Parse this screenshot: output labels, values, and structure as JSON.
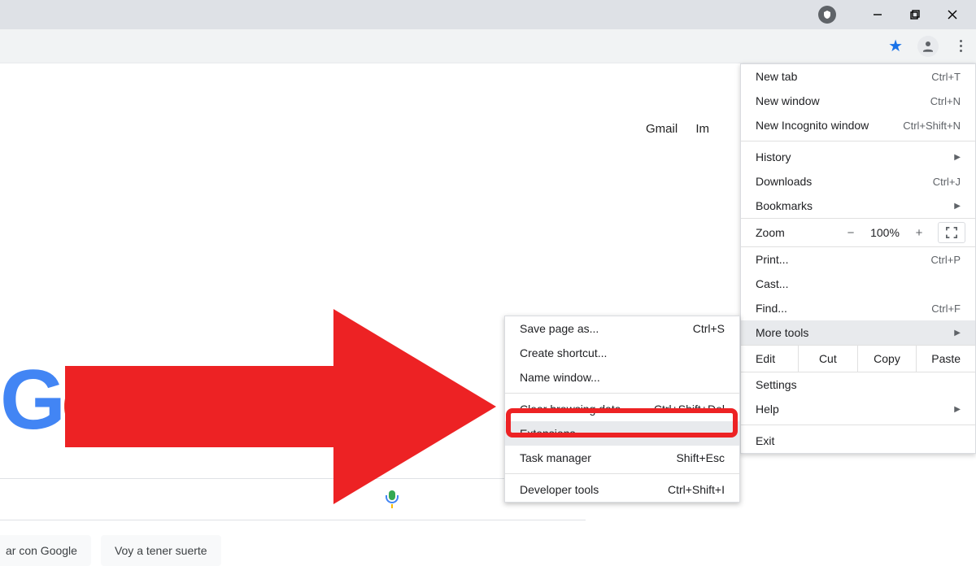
{
  "nav": {
    "gmail": "Gmail",
    "images": "Im"
  },
  "search_buttons": {
    "search": "ar con Google",
    "lucky": "Voy a tener suerte"
  },
  "menu": {
    "new_tab": {
      "label": "New tab",
      "shortcut": "Ctrl+T"
    },
    "new_window": {
      "label": "New window",
      "shortcut": "Ctrl+N"
    },
    "incognito": {
      "label": "New Incognito window",
      "shortcut": "Ctrl+Shift+N"
    },
    "history": {
      "label": "History"
    },
    "downloads": {
      "label": "Downloads",
      "shortcut": "Ctrl+J"
    },
    "bookmarks": {
      "label": "Bookmarks"
    },
    "zoom": {
      "label": "Zoom",
      "value": "100%"
    },
    "print": {
      "label": "Print...",
      "shortcut": "Ctrl+P"
    },
    "cast": {
      "label": "Cast..."
    },
    "find": {
      "label": "Find...",
      "shortcut": "Ctrl+F"
    },
    "more_tools": {
      "label": "More tools"
    },
    "edit": {
      "label": "Edit",
      "cut": "Cut",
      "copy": "Copy",
      "paste": "Paste"
    },
    "settings": {
      "label": "Settings"
    },
    "help": {
      "label": "Help"
    },
    "exit": {
      "label": "Exit"
    }
  },
  "submenu": {
    "save_as": {
      "label": "Save page as...",
      "shortcut": "Ctrl+S"
    },
    "shortcut": {
      "label": "Create shortcut..."
    },
    "name_win": {
      "label": "Name window..."
    },
    "clear": {
      "label": "Clear browsing data...",
      "shortcut": "Ctrl+Shift+Del"
    },
    "extensions": {
      "label": "Extensions"
    },
    "task_mgr": {
      "label": "Task manager",
      "shortcut": "Shift+Esc"
    },
    "dev_tools": {
      "label": "Developer tools",
      "shortcut": "Ctrl+Shift+I"
    }
  }
}
